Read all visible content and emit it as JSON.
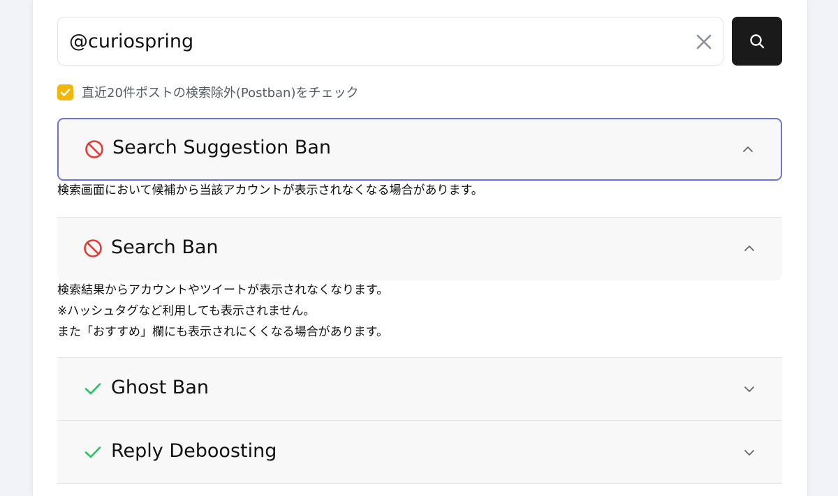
{
  "search": {
    "value": "@curiospring",
    "clear_icon": "close-icon",
    "button_icon": "search-icon"
  },
  "postban_check": {
    "checked": true,
    "label": "直近20件ポストの検索除外(Postban)をチェック"
  },
  "results": [
    {
      "title": "Search Suggestion Ban",
      "status": "banned",
      "status_icon": "prohibited-icon",
      "expanded": true,
      "description": [
        "検索画面において候補から当該アカウントが表示されなくなる場合があります。"
      ]
    },
    {
      "title": "Search Ban",
      "status": "banned",
      "status_icon": "prohibited-icon",
      "expanded": true,
      "description": [
        "検索結果からアカウントやツイートが表示されなくなります。",
        "※ハッシュタグなど利用しても表示されません。",
        "また「おすすめ」欄にも表示されにくくなる場合があります。"
      ]
    },
    {
      "title": "Ghost Ban",
      "status": "ok",
      "status_icon": "check-icon",
      "expanded": false
    },
    {
      "title": "Reply Deboosting",
      "status": "ok",
      "status_icon": "check-icon",
      "expanded": false
    }
  ],
  "colors": {
    "banned": "#e53935",
    "ok": "#22c55e",
    "checkbox": "#f2b705",
    "focus_border": "#6b73e0",
    "search_button": "#1a1a1a"
  }
}
